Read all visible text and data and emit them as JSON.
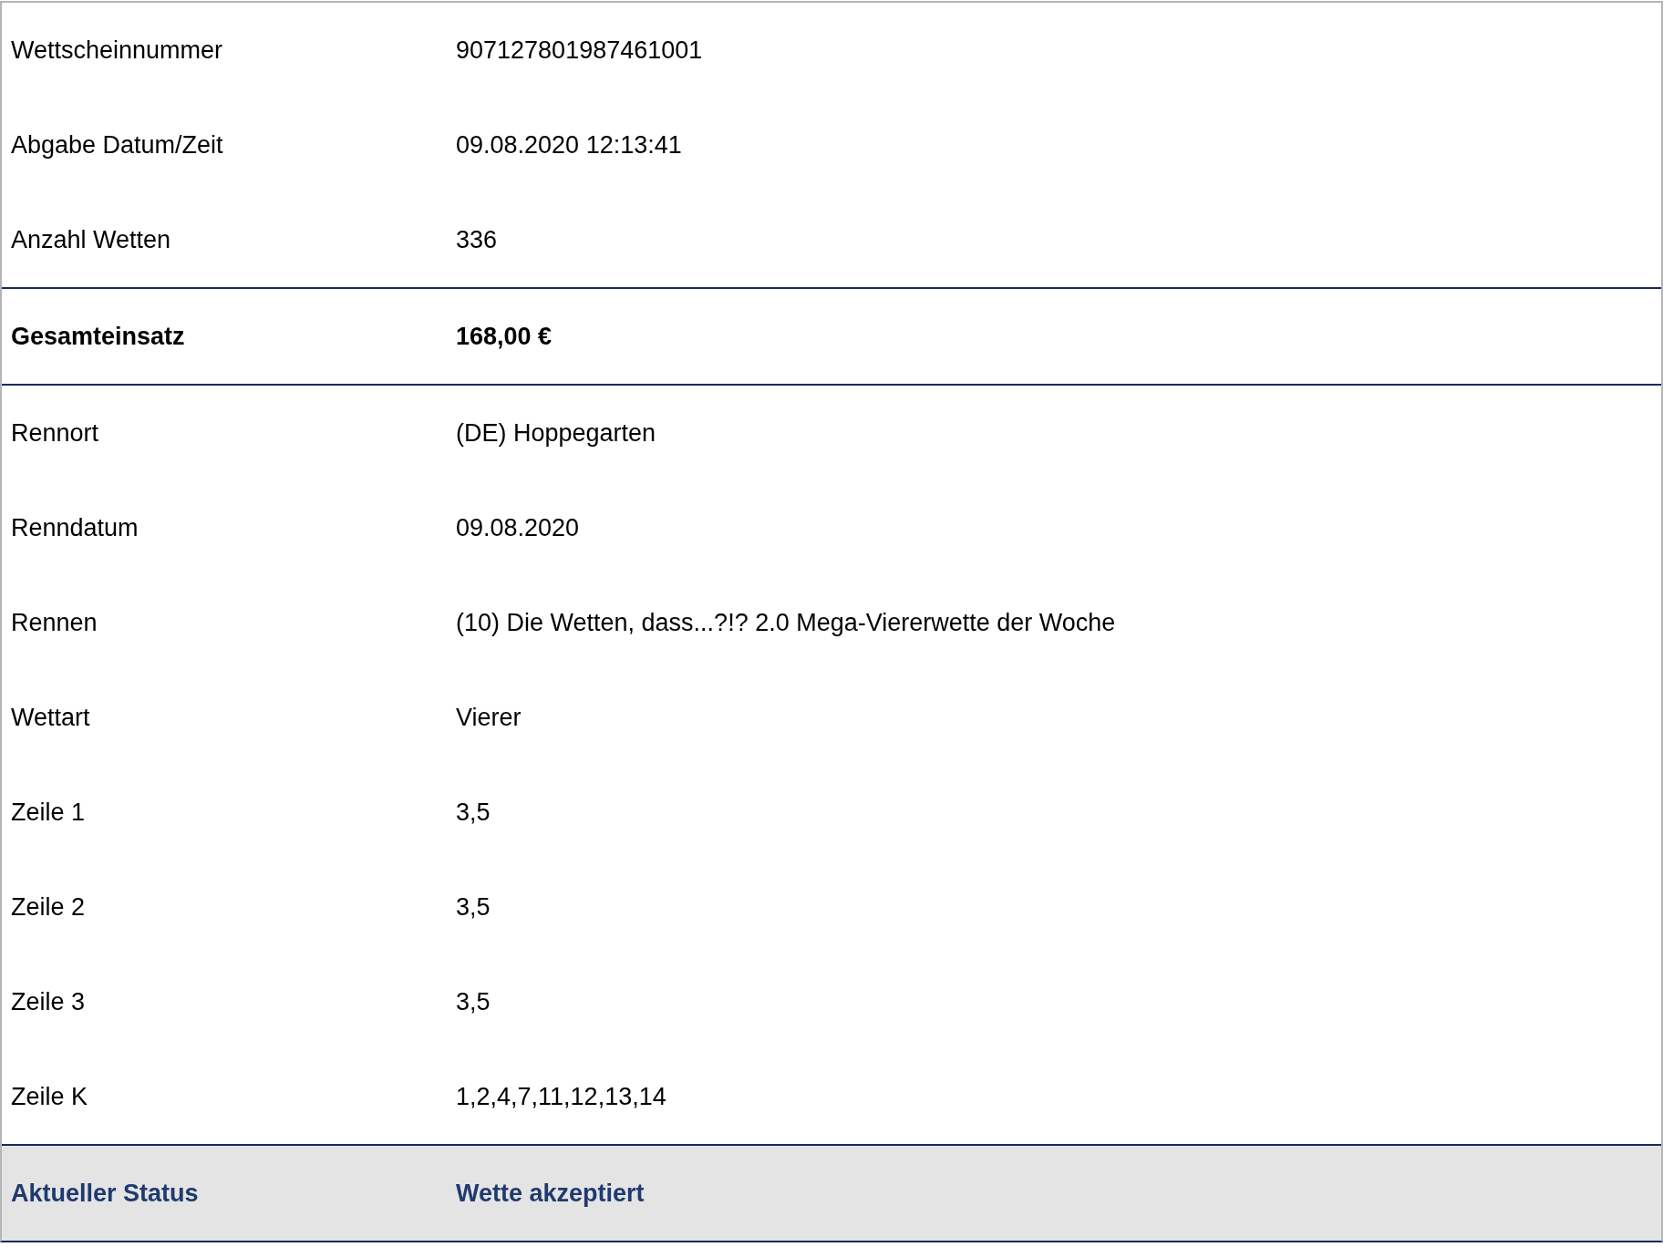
{
  "sections": [
    {
      "kind": "plain",
      "rows": [
        {
          "label": "Wettscheinnummer",
          "value": "907127801987461001"
        },
        {
          "label": "Abgabe Datum/Zeit",
          "value": "09.08.2020 12:13:41"
        },
        {
          "label": "Anzahl Wetten",
          "value": "336"
        }
      ]
    },
    {
      "kind": "total",
      "rows": [
        {
          "label": "Gesamteinsatz",
          "value": "168,00 €"
        }
      ]
    },
    {
      "kind": "plain",
      "rows": [
        {
          "label": "Rennort",
          "value": "(DE) Hoppegarten"
        },
        {
          "label": "Renndatum",
          "value": "09.08.2020"
        },
        {
          "label": "Rennen",
          "value": "(10) Die Wetten, dass...?!? 2.0 Mega-Viererwette der Woche"
        },
        {
          "label": "Wettart",
          "value": "Vierer"
        },
        {
          "label": "Zeile 1",
          "value": "3,5"
        },
        {
          "label": "Zeile 2",
          "value": "3,5"
        },
        {
          "label": "Zeile 3",
          "value": "3,5"
        },
        {
          "label": "Zeile K",
          "value": "1,2,4,7,11,12,13,14"
        }
      ]
    },
    {
      "kind": "status",
      "rows": [
        {
          "label": "Aktueller Status",
          "value": "Wette akzeptiert"
        }
      ]
    }
  ]
}
